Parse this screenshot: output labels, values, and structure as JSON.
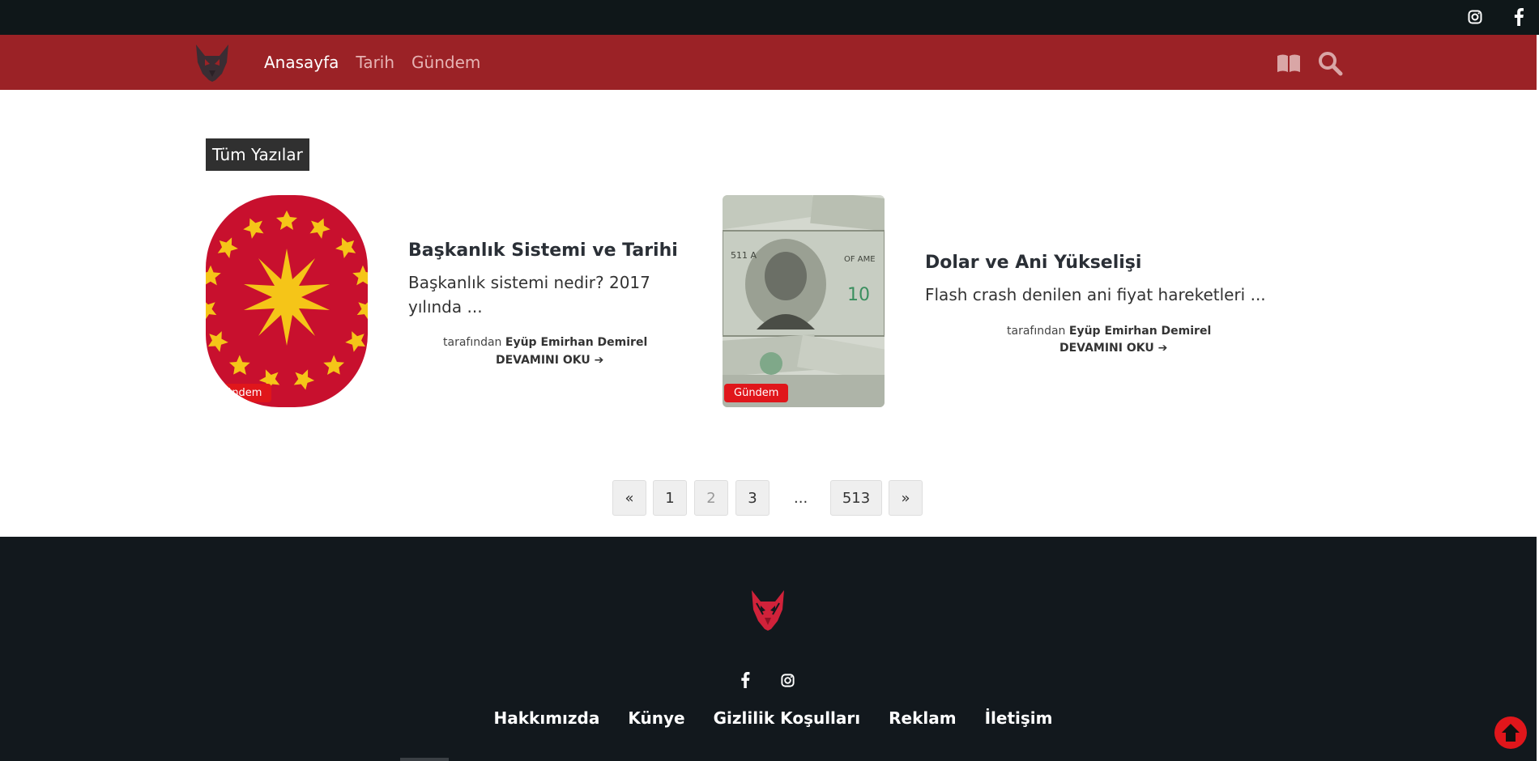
{
  "topbar": {
    "instagram_icon": "instagram-icon",
    "facebook_icon": "facebook-icon"
  },
  "nav": {
    "logo": "wolf-logo",
    "links": [
      {
        "label": "Anasayfa",
        "active": true
      },
      {
        "label": "Tarih",
        "active": false
      },
      {
        "label": "Gündem",
        "active": false
      }
    ],
    "book_icon": "book-icon",
    "search_icon": "search-icon"
  },
  "main": {
    "section_label": "Tüm Yazılar",
    "posts": [
      {
        "title": "Başkanlık Sistemi ve Tarihi",
        "excerpt": "Başkanlık sistemi nedir? 2017 yılında ...",
        "category": "Gündem",
        "by_label": "tarafından",
        "author": "Eyüp Emirhan Demirel",
        "read_more": "DEVAMINI OKU"
      },
      {
        "title": "Dolar ve Ani Yükselişi",
        "excerpt": "Flash crash denilen ani fiyat hareketleri ...",
        "category": "Gündem",
        "by_label": "tarafından",
        "author": "Eyüp Emirhan Demirel",
        "read_more": "DEVAMINI OKU"
      }
    ]
  },
  "pagination": {
    "prev": "«",
    "pages": [
      "1",
      "2",
      "3"
    ],
    "current": "2",
    "dots": "...",
    "last": "513",
    "next": "»"
  },
  "footer": {
    "links": [
      "Hakkımızda",
      "Künye",
      "Gizlilik Koşulları",
      "Reklam",
      "İletişim"
    ]
  },
  "colors": {
    "nav_red": "#9b2226",
    "accent_red": "#e0161b",
    "dark": "#12181d"
  }
}
